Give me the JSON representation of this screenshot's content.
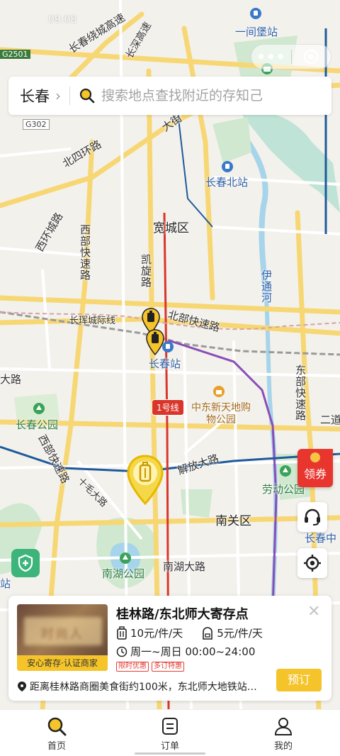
{
  "status_bar": {
    "time": "09:08"
  },
  "capsule": {
    "more": "•••"
  },
  "search": {
    "city": "长春",
    "placeholder": "搜索地点查找附近的存知己"
  },
  "map": {
    "labels": {
      "changchun_ring": "长春绕城高速",
      "changshen_ring": "长深高速",
      "g2501": "G2501",
      "g302": "G302",
      "yijianbao": "一间堡站",
      "beisihuan": "北四环路",
      "dajie": "大街",
      "changchun_north": "长春北站",
      "kuancheng": "宽城区",
      "xibu_expressway": "西部快速路",
      "xihuan": "西环城路",
      "kaixuan": "凯旋路",
      "yitong_river": "伊通河",
      "beibu_expressway": "北部快速路",
      "changhui": "长珲城际线",
      "changchun_station": "长春站",
      "line1": "1号线",
      "dalu": "大路",
      "zhongdong": "中东新天地购物公园",
      "dongbu_expressway": "东部快速路",
      "erdao": "二道",
      "changchun_park": "长春公园",
      "xibu_expressway2": "西部快速路",
      "jiefang": "解放大路",
      "shangbao": "十毛大路",
      "laodong_park": "劳动公园",
      "nanguan": "南关区",
      "changchun_zhong": "长春中",
      "nanhu_park": "南湖公园",
      "nanhu_road": "南湖大路",
      "station_left": "站",
      "line1_bottom": "1号线"
    }
  },
  "floating": {
    "coupon": "领券"
  },
  "card": {
    "title": "桂林路/东北师大寄存点",
    "badge": "安心寄存·认证商家",
    "price_large": "10元/件/天",
    "price_small": "5元/件/天",
    "hours": "周一~周日 00:00~24:00",
    "tags": [
      "限时优惠",
      "多订特惠"
    ],
    "distance": "距离桂林路商圈美食街约100米，东北师大地铁站…",
    "book": "预订",
    "thumb_text": "时尚人"
  },
  "tabs": [
    {
      "label": "首页",
      "icon": "search-icon"
    },
    {
      "label": "订单",
      "icon": "order-icon"
    },
    {
      "label": "我的",
      "icon": "user-icon"
    }
  ],
  "colors": {
    "accent": "#f5c42a",
    "coupon": "#e8352e",
    "shield": "#3cb47a"
  }
}
